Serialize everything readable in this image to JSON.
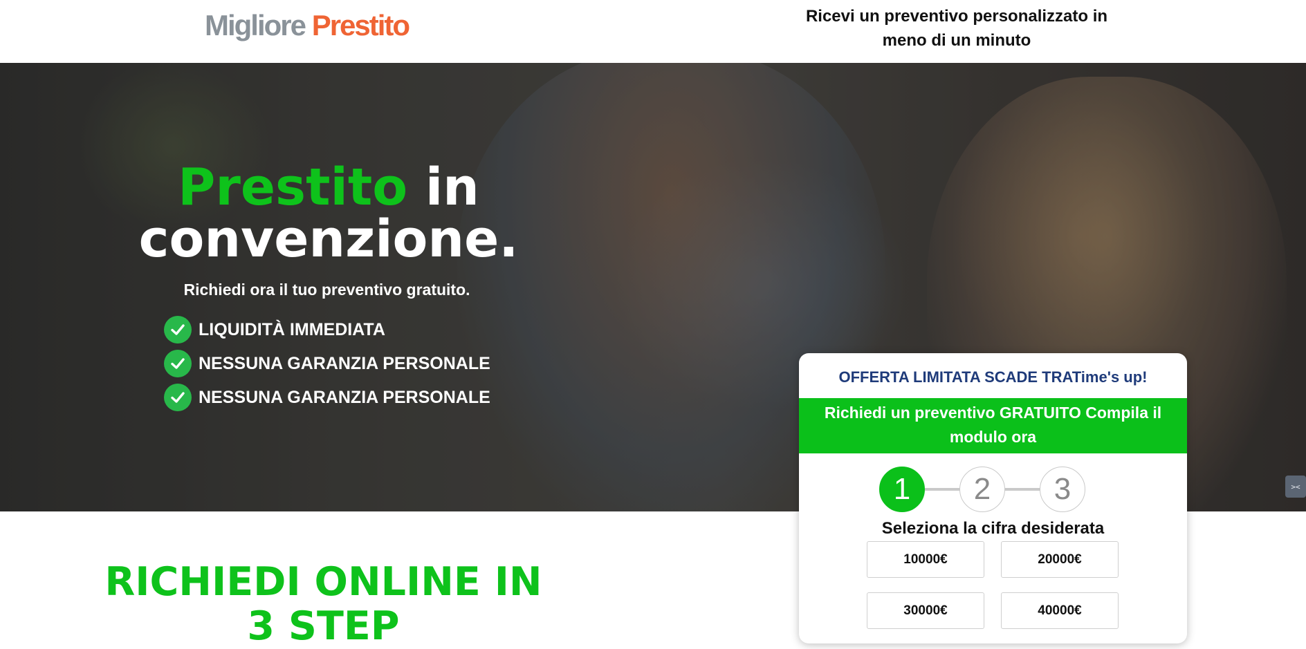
{
  "header": {
    "logo": {
      "part1": "Migliore",
      "part2": "Prestito"
    },
    "tagline": "Ricevi un preventivo personalizzato in meno di un minuto"
  },
  "hero": {
    "title_green": "Prestito",
    "title_white": "in convenzione.",
    "subtitle": "Richiedi ora il tuo preventivo gratuito.",
    "features": [
      {
        "icon": "check-circle-icon",
        "label": "LIQUIDITÀ IMMEDIATA"
      },
      {
        "icon": "check-circle-icon",
        "label": "NESSUNA GARANZIA PERSONALE"
      },
      {
        "icon": "check-circle-icon",
        "label": "NESSUNA GARANZIA PERSONALE"
      }
    ],
    "side_widget_icon": "collapse-arrows-icon"
  },
  "form_card": {
    "timer_text": "OFFERTA LIMITATA SCADE TRATime's up!",
    "banner": "Richiedi un preventivo GRATUITO Compila il modulo ora",
    "steps": [
      "1",
      "2",
      "3"
    ],
    "active_step": 1,
    "question": "Seleziona la cifra desiderata",
    "amounts": [
      "10000€",
      "20000€",
      "30000€",
      "40000€"
    ]
  },
  "steps_section": {
    "heading": "RICHIEDI ONLINE IN 3 STEP"
  },
  "colors": {
    "brand_green": "#0ec21b",
    "logo_grey": "#8a9299",
    "logo_orange": "#ef6434",
    "timer_blue": "#1f3b7a"
  }
}
